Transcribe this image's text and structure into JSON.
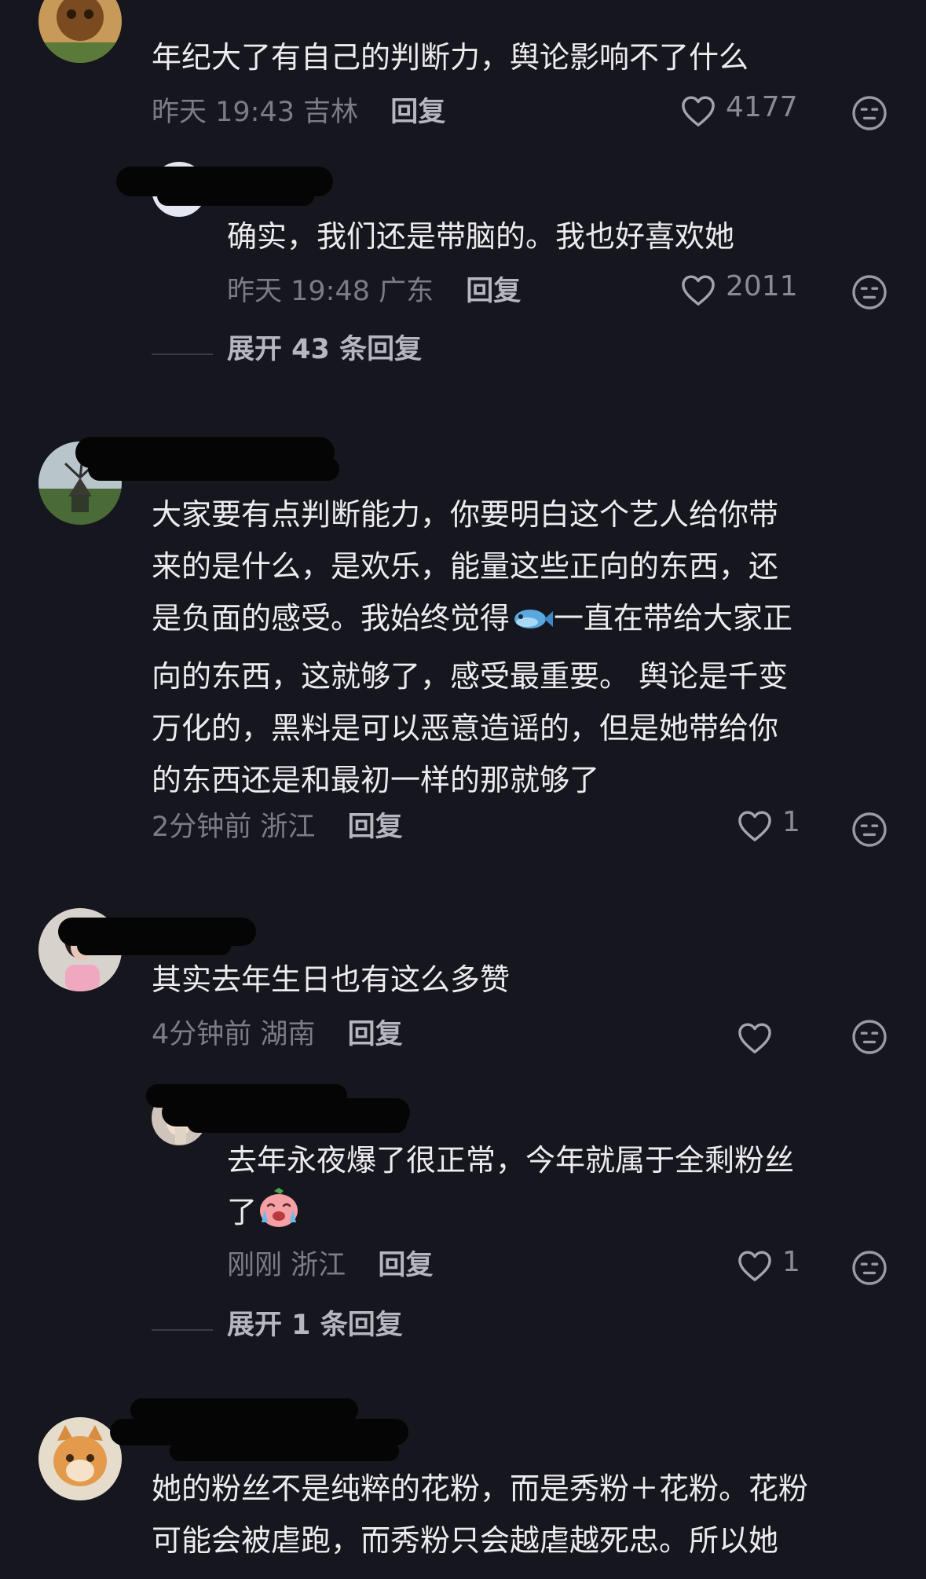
{
  "comments": [
    {
      "text": "年纪大了有自己的判断力，舆论影响不了什么",
      "time": "昨天 19:43",
      "location": "吉林",
      "reply_label": "回复",
      "likes": "4177",
      "replies": [
        {
          "text": "确实，我们还是带脑的。我也好喜欢她",
          "time": "昨天 19:48",
          "location": "广东",
          "reply_label": "回复",
          "likes": "2011"
        }
      ],
      "expand_label": "展开 43 条回复"
    },
    {
      "text_part1": "大家要有点判断能力，你要明白这个艺人给你带\n来的是什么，是欢乐，能量这些正向的东西，还\n是负面的感受。我始终觉得",
      "text_part2": "一直在带给大家正\n向的东西，这就够了，感受最重要。 舆论是千变\n万化的，黑料是可以恶意造谣的，但是她带给你\n的东西还是和最初一样的那就够了",
      "time": "2分钟前",
      "location": "浙江",
      "reply_label": "回复",
      "likes": "1"
    },
    {
      "text": "其实去年生日也有这么多赞",
      "time": "4分钟前",
      "location": "湖南",
      "reply_label": "回复",
      "likes": "",
      "replies": [
        {
          "text": "去年永夜爆了很正常，今年就属于全剩粉丝\n了",
          "time": "刚刚",
          "location": "浙江",
          "reply_label": "回复",
          "likes": "1"
        }
      ],
      "expand_label": "展开 1 条回复"
    },
    {
      "text": "她的粉丝不是纯粹的花粉，而是秀粉＋花粉。花粉\n可能会被虐跑，而秀粉只会越虐越死忠。所以她"
    }
  ],
  "icons": {
    "like": "heart-outline-icon",
    "dislike": "neutral-face-icon",
    "emoji_fish": "fish-emoji",
    "emoji_crying": "crying-emoji"
  },
  "colors": {
    "background": "#16161e",
    "text": "#ececee",
    "meta": "#7c7c86",
    "reply": "#b6b6be"
  }
}
